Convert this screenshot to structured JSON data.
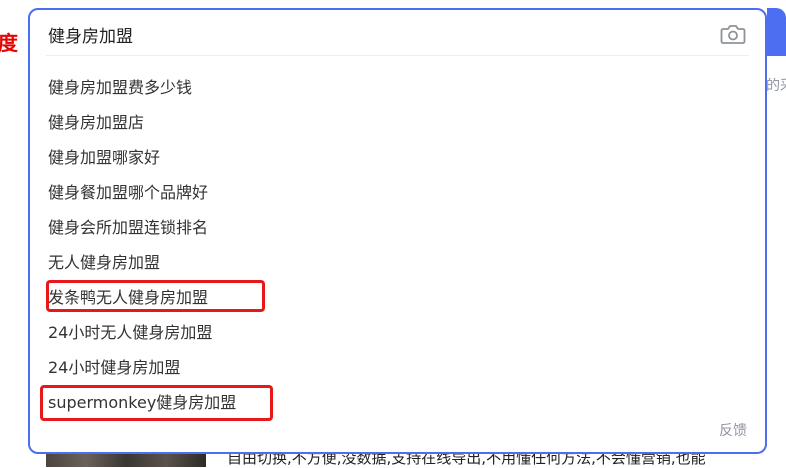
{
  "background": {
    "logo_fragment": "度",
    "right_fragment": "的采",
    "body_text": "自由切换,不方便,没数据,支持在线导出,不用懂任何方法,不会懂营销,也能"
  },
  "search": {
    "query": "健身房加盟",
    "camera_icon": "camera-icon",
    "feedback_label": "反馈",
    "suggestions": [
      "健身房加盟费多少钱",
      "健身房加盟店",
      "健身加盟哪家好",
      "健身餐加盟哪个品牌好",
      "健身会所加盟连锁排名",
      "无人健身房加盟",
      "发条鸭无人健身房加盟",
      "24小时无人健身房加盟",
      "24小时健身房加盟",
      "supermonkey健身房加盟"
    ]
  },
  "colors": {
    "accent": "#4e6ef2",
    "highlight_box": "#e8181a",
    "logo_red": "#e10601"
  }
}
